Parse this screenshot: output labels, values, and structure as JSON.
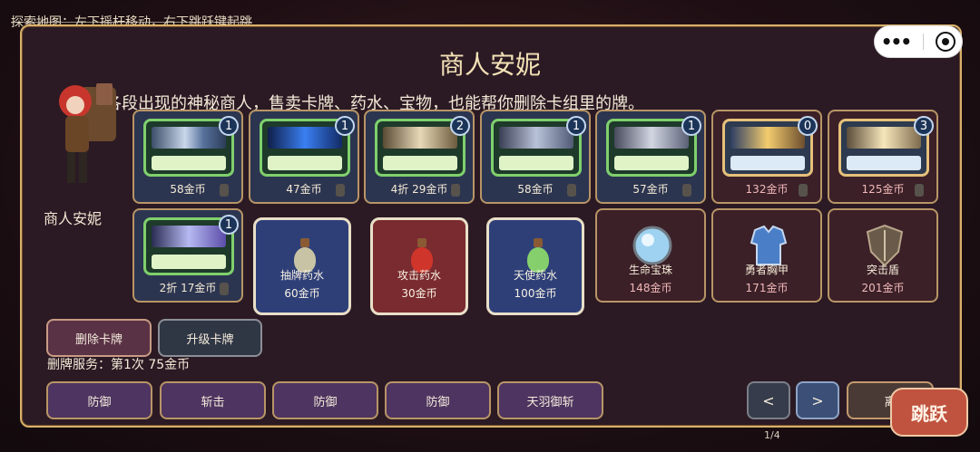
{
  "hint": "探索地图：左下摇杆移动，右下跳跃键起跳",
  "title": "商人安妮",
  "description": "各段出现的神秘商人，售卖卡牌、药水、宝物，也能帮你删除卡组里的牌。",
  "npc_name": "商人安妮",
  "cards_row1": [
    {
      "price": "58金币",
      "count": "1"
    },
    {
      "price": "47金币",
      "count": "1"
    },
    {
      "price": "4折 29金币",
      "count": "2"
    },
    {
      "price": "58金币",
      "count": "1"
    },
    {
      "price": "57金币",
      "count": "1"
    },
    {
      "price": "132金币",
      "count": "0"
    },
    {
      "price": "125金币",
      "count": "3"
    }
  ],
  "card_row2": {
    "price": "2折 17金币",
    "count": "1"
  },
  "potions": [
    {
      "name": "抽牌药水",
      "price": "60金币",
      "color": "#2e3f78"
    },
    {
      "name": "攻击药水",
      "price": "30金币",
      "color": "#7a2b2f"
    },
    {
      "name": "天使药水",
      "price": "100金币",
      "color": "#2e3f78"
    }
  ],
  "relics": [
    {
      "name": "生命宝珠",
      "price": "148金币",
      "icon": "orb-icon"
    },
    {
      "name": "勇者胸甲",
      "price": "171金币",
      "icon": "armor-icon"
    },
    {
      "name": "突击盾",
      "price": "201金币",
      "icon": "shield-icon"
    }
  ],
  "buttons": {
    "remove": "删除卡牌",
    "upgrade": "升级卡牌",
    "prev": "<",
    "next": ">",
    "leave": "离",
    "jump": "跳跃"
  },
  "service_text": "删牌服务：第1次 75金币",
  "deck": [
    "防御",
    "斩击",
    "防御",
    "防御",
    "天羽御斩"
  ],
  "page_indicator": "1/4",
  "mini_menu": "•••"
}
